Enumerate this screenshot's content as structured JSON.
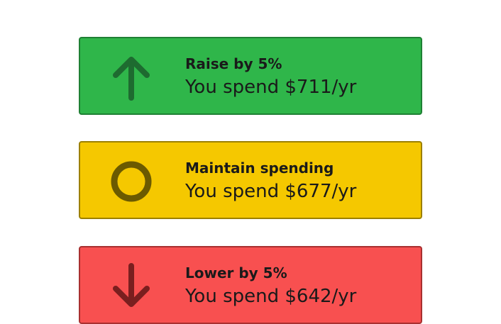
{
  "options": [
    {
      "id": "raise",
      "icon": "arrow-up-icon",
      "title": "Raise by 5%",
      "subtitle": "You spend $711/yr",
      "color": "#2fb64a"
    },
    {
      "id": "maintain",
      "icon": "circle-icon",
      "title": "Maintain spending",
      "subtitle": "You spend $677/yr",
      "color": "#f5c800"
    },
    {
      "id": "lower",
      "icon": "arrow-down-icon",
      "title": "Lower by 5%",
      "subtitle": "You spend $642/yr",
      "color": "#f85050"
    }
  ]
}
